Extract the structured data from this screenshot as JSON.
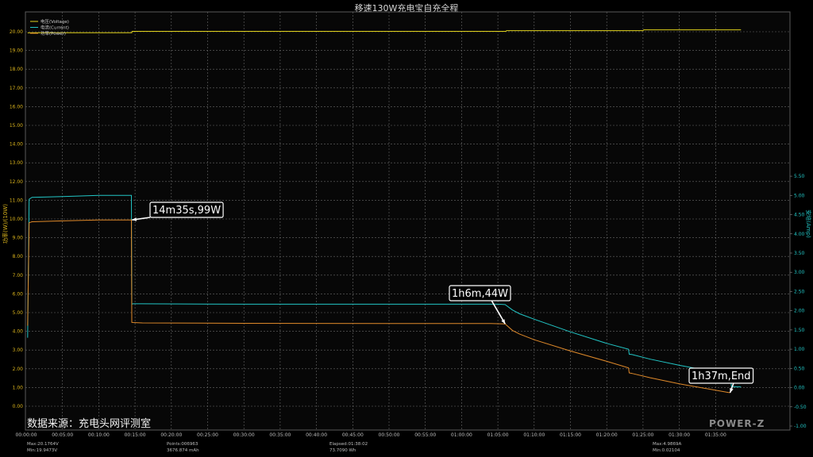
{
  "chart_data": {
    "type": "line",
    "title": "移速130W充电宝自充全程",
    "ylabel_left": "功率(W)/(10W)",
    "ylabel_right": "安培(Amp)",
    "ylim_left": [
      0,
      20.5
    ],
    "ylim_right": [
      -1,
      5.75
    ],
    "xlim_minutes": [
      0,
      98.5
    ],
    "grid": true,
    "legend_position": "top-left",
    "x_tick_labels": [
      "00:00:00",
      "00:05:00",
      "00:10:00",
      "00:15:00",
      "00:20:00",
      "00:25:00",
      "00:30:00",
      "00:35:00",
      "00:40:00",
      "00:45:00",
      "00:50:00",
      "00:55:00",
      "01:00:00",
      "01:05:00",
      "01:10:00",
      "01:15:00",
      "01:20:00",
      "01:25:00",
      "01:30:00",
      "01:35:00"
    ],
    "y_left_tick_labels": [
      "0.00",
      "1.00",
      "2.00",
      "3.00",
      "4.00",
      "5.00",
      "6.00",
      "7.00",
      "8.00",
      "9.00",
      "10.00",
      "11.00",
      "12.00",
      "13.00",
      "14.00",
      "15.00",
      "16.00",
      "17.00",
      "18.00",
      "19.00",
      "20.00"
    ],
    "y_right_tick_labels": [
      "-1.00",
      "-0.50",
      "0.00",
      "0.50",
      "1.00",
      "1.50",
      "2.00",
      "2.50",
      "3.00",
      "3.50",
      "4.00",
      "4.50",
      "5.00",
      "5.50"
    ],
    "series": [
      {
        "name": "电压(Voltage)",
        "color": "#e0d21c",
        "axis": "left",
        "x": [
          0.2,
          1,
          14.55,
          14.6,
          66.1,
          66.2,
          85,
          85.1,
          98.5
        ],
        "y": [
          19.94,
          19.95,
          19.95,
          20.02,
          20.02,
          20.06,
          20.06,
          20.1,
          20.1
        ]
      },
      {
        "name": "电流(Current)",
        "color": "#22c6c6",
        "axis": "right",
        "x": [
          0.2,
          0.4,
          0.8,
          5,
          10,
          14.5,
          14.55,
          14.7,
          16,
          30,
          50,
          64,
          65,
          66,
          67,
          68,
          70,
          75,
          80,
          83,
          83.1,
          83.5,
          86,
          90,
          96.5,
          97,
          97.2,
          98.5
        ],
        "y": [
          1.3,
          4.9,
          4.95,
          4.97,
          5.0,
          5.0,
          2.17,
          2.18,
          2.18,
          2.17,
          2.17,
          2.17,
          2.17,
          2.16,
          2.02,
          1.92,
          1.78,
          1.45,
          1.15,
          1.0,
          0.87,
          0.86,
          0.74,
          0.58,
          0.35,
          0.32,
          0.02,
          0.02
        ]
      },
      {
        "name": "功率(Power)",
        "color": "#e08a2a",
        "axis": "left",
        "x": [
          0.2,
          0.4,
          0.8,
          5,
          10,
          14.5,
          14.55,
          14.7,
          16,
          30,
          50,
          64,
          66,
          67,
          68,
          70,
          75,
          80,
          83,
          83.1,
          83.5,
          86,
          90,
          96.5,
          97
        ],
        "y": [
          4.3,
          9.8,
          9.85,
          9.9,
          9.95,
          9.95,
          4.48,
          4.47,
          4.45,
          4.43,
          4.42,
          4.42,
          4.4,
          4.05,
          3.85,
          3.55,
          2.95,
          2.4,
          2.05,
          1.78,
          1.75,
          1.52,
          1.2,
          0.75,
          0.72
        ]
      }
    ],
    "annotations": [
      {
        "text": "14m35s,99W",
        "x": 14.58,
        "y": 9.95
      },
      {
        "text": "1h6m,44W",
        "x": 66,
        "y": 4.4
      },
      {
        "text": "1h37m,End",
        "x": 97,
        "y": 0.72
      }
    ]
  },
  "stats": {
    "voltage_max": "Max:20.1764V",
    "voltage_min": "Min:19.9473V",
    "points": "Points:006963",
    "capacity": "3676.874 mAh",
    "elapsed": "Elapsed:01:38:02",
    "energy": "73.7090 Wh",
    "current_max": "Max:4.9869A",
    "current_min": "Min:0.02104"
  },
  "watermark_source": "数据来源：充电头网评测室",
  "logo_text": "POWER-Z"
}
